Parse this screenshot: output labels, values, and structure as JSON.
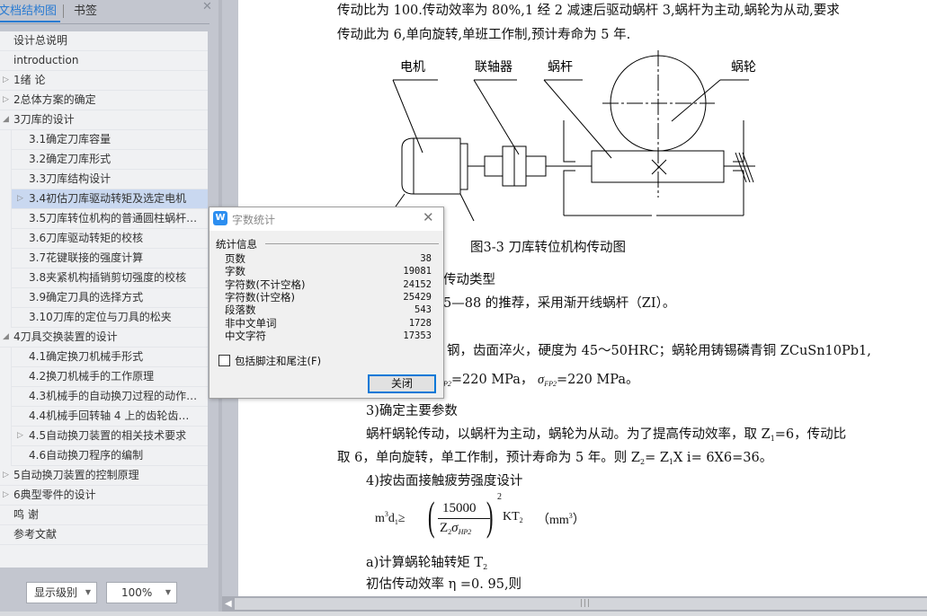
{
  "nav": {
    "tabs": [
      {
        "label": "文档结构图",
        "active": true
      },
      {
        "label": "书签",
        "active": false
      }
    ],
    "close_icon": "close-icon",
    "items": [
      {
        "label": "设计总说明",
        "level": 1,
        "expander": ""
      },
      {
        "label": "introduction",
        "level": 1,
        "expander": ""
      },
      {
        "label": "1绪  论",
        "level": 1,
        "expander": "▷"
      },
      {
        "label": "2总体方案的确定",
        "level": 1,
        "expander": "▷"
      },
      {
        "label": "3刀库的设计",
        "level": 1,
        "expander": "◢"
      },
      {
        "label": "3.1确定刀库容量",
        "level": 2,
        "expander": ""
      },
      {
        "label": "3.2确定刀库形式",
        "level": 2,
        "expander": ""
      },
      {
        "label": "3.3刀库结构设计",
        "level": 2,
        "expander": ""
      },
      {
        "label": "3.4初估刀库驱动转矩及选定电机",
        "level": 2,
        "expander": "▷",
        "selected": true
      },
      {
        "label": "3.5刀库转位机构的普通圆柱蜗杆 ...",
        "level": 2,
        "expander": ""
      },
      {
        "label": "3.6刀库驱动转矩的校核",
        "level": 2,
        "expander": ""
      },
      {
        "label": "3.7花键联接的强度计算",
        "level": 2,
        "expander": ""
      },
      {
        "label": "3.8夹紧机构插销剪切强度的校核",
        "level": 2,
        "expander": ""
      },
      {
        "label": "3.9确定刀具的选择方式",
        "level": 2,
        "expander": ""
      },
      {
        "label": "3.10刀库的定位与刀具的松夹",
        "level": 2,
        "expander": ""
      },
      {
        "label": "4刀具交换装置的设计",
        "level": 1,
        "expander": "◢"
      },
      {
        "label": "4.1确定换刀机械手形式",
        "level": 2,
        "expander": ""
      },
      {
        "label": "4.2换刀机械手的工作原理",
        "level": 2,
        "expander": ""
      },
      {
        "label": "4.3机械手的自动换刀过程的动作 ...",
        "level": 2,
        "expander": ""
      },
      {
        "label": "4.4机械手回转轴 4 上的齿轮齿条 ...",
        "level": 2,
        "expander": ""
      },
      {
        "label": "4.5自动换刀装置的相关技术要求",
        "level": 2,
        "expander": "▷"
      },
      {
        "label": "4.6自动换刀程序的编制",
        "level": 2,
        "expander": ""
      },
      {
        "label": "5自动换刀装置的控制原理",
        "level": 1,
        "expander": "▷"
      },
      {
        "label": "6典型零件的设计",
        "level": 1,
        "expander": "▷"
      },
      {
        "label": "鸣    谢",
        "level": 1,
        "expander": ""
      },
      {
        "label": "参考文献",
        "level": 1,
        "expander": ""
      }
    ],
    "level_dropdown": "显示级别",
    "zoom_dropdown": "100%"
  },
  "document": {
    "line1": "传动比为 100.传动效率为 80%,1 经 2 减速后驱动蜗杆 3,蜗杆为主动,蜗轮为从动,要求",
    "line2": "传动此为 6,单向旋转,单班工作制,预计寿命为 5 年.",
    "figure": {
      "labels": {
        "motor": "电机",
        "coupling": "联轴器",
        "worm": "蜗杆",
        "worm_wheel": "蜗轮"
      },
      "caption": "图3-3  刀库转位机构传动图"
    },
    "p_type": "传动类型",
    "p_recommend": "5—88 的推荐，采用渐开线蜗杆（ZI）。",
    "p_material": "钢，齿面淬火，硬度为 45～50HRC；蜗轮用铸锡磷青铜 ZCuSn10Pb1,",
    "p_stress_a": "=220  MPa，",
    "p_stress_b": "=220  MPa。",
    "p_stress_sub_a": "P2",
    "p_stress_sub_b": "FP2",
    "h3": "3)确定主要参数",
    "p3a": "蜗杆蜗轮传动，以蜗杆为主动，蜗轮为从动。为了提高传动效率，取 Z",
    "p3a_tail": "=6，传动比",
    "p3b_head": "取 6，单向旋转，单工作制，预计寿命为 5 年。则 Z",
    "p3b_mid": "= Z",
    "p3b_tail": "X i=  6X6=36。",
    "h4": "4)按齿面接触疲劳强度设计",
    "formula": {
      "lhs": "m",
      "lhs2": "d",
      "geq": "≥",
      "numerator": "15000",
      "denominator": "Z",
      "den_sigma": "σ",
      "den_sub": "HP2",
      "exponent": "2",
      "rhs": "KT",
      "unit": "（mm",
      "unit_close": "）"
    },
    "pa": "a)计算蜗轮轴转矩 T",
    "pb": "初估传动效率 η =0. 95,则"
  },
  "dialog": {
    "title": "字数统计",
    "group_label": "统计信息",
    "stats": [
      {
        "label": "页数",
        "value": "38"
      },
      {
        "label": "字数",
        "value": "19081"
      },
      {
        "label": "字符数(不计空格)",
        "value": "24152"
      },
      {
        "label": "字符数(计空格)",
        "value": "25429"
      },
      {
        "label": "段落数",
        "value": "543"
      },
      {
        "label": "非中文单词",
        "value": "1728"
      },
      {
        "label": "中文字符",
        "value": "17353"
      }
    ],
    "checkbox_label": "包括脚注和尾注(F)",
    "checkbox_checked": false,
    "close_button": "关闭",
    "accent": "#0078d7"
  }
}
